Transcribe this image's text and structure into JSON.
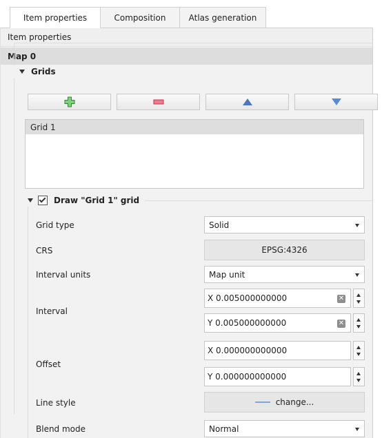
{
  "tabs": [
    {
      "label": "Item properties",
      "active": true
    },
    {
      "label": "Composition",
      "active": false
    },
    {
      "label": "Atlas generation",
      "active": false
    }
  ],
  "panel": {
    "title": "Item properties",
    "item_name": "Map 0"
  },
  "grids": {
    "title": "Grids",
    "toolbar": [
      {
        "icon": "add-icon",
        "color": "#3aa03a"
      },
      {
        "icon": "remove-icon",
        "color": "#e0506a"
      },
      {
        "icon": "move-up-icon",
        "color": "#4a78b8"
      },
      {
        "icon": "move-down-icon",
        "color": "#5a8ad0"
      }
    ],
    "items": [
      "Grid 1"
    ]
  },
  "draw_grid": {
    "label": "Draw \"Grid 1\" grid",
    "checked": true,
    "grid_type": {
      "label": "Grid type",
      "value": "Solid"
    },
    "crs": {
      "label": "CRS",
      "value": "EPSG:4326"
    },
    "interval_units": {
      "label": "Interval units",
      "value": "Map unit"
    },
    "interval": {
      "label": "Interval",
      "x": "X 0.005000000000",
      "y": "Y 0.005000000000"
    },
    "offset": {
      "label": "Offset",
      "x": "X 0.000000000000",
      "y": "Y 0.000000000000"
    },
    "line_style": {
      "label": "Line style",
      "button": "change..."
    },
    "blend_mode": {
      "label": "Blend mode",
      "value": "Normal"
    }
  },
  "colors": {
    "line_preview": "#7fa8d8"
  }
}
